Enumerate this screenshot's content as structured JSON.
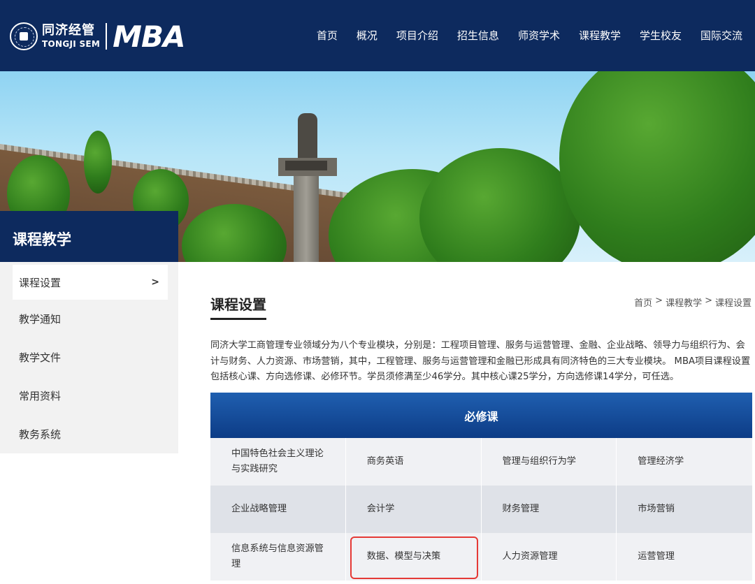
{
  "header": {
    "logo_cn": "同济经管",
    "logo_en": "TONGJI SEM",
    "logo_mba": "MBA",
    "nav": [
      "首页",
      "概况",
      "项目介绍",
      "招生信息",
      "师资学术",
      "课程教学",
      "学生校友",
      "国际交流"
    ]
  },
  "sidebar": {
    "title": "课程教学",
    "items": [
      {
        "label": "课程设置",
        "arrow": ">"
      },
      {
        "label": "教学通知"
      },
      {
        "label": "教学文件"
      },
      {
        "label": "常用资料"
      },
      {
        "label": "教务系统"
      }
    ]
  },
  "main": {
    "title": "课程设置",
    "breadcrumb": [
      "首页",
      ">",
      "课程教学",
      ">",
      "课程设置"
    ],
    "intro": "同济大学工商管理专业领域分为八个专业模块，分别是：工程项目管理、服务与运营管理、金融、企业战略、领导力与组织行为、会计与财务、人力资源、市场营销，其中，工程管理、服务与运营管理和金融已形成具有同济特色的三大专业模块。 MBA项目课程设置包括核心课、方向选修课、必修环节。学员须修满至少46学分。其中核心课25学分，方向选修课14学分，可任选。",
    "table": {
      "header": "必修课",
      "rows": [
        [
          "中国特色社会主义理论与实践研究",
          "商务英语",
          "管理与组织行为学",
          "管理经济学"
        ],
        [
          "企业战略管理",
          "会计学",
          "财务管理",
          "市场营销"
        ],
        [
          "信息系统与信息资源管理",
          "数据、模型与决策",
          "人力资源管理",
          "运营管理"
        ]
      ]
    }
  },
  "colors": {
    "navy": "#0d2a5e",
    "table_header": "#1f5fb0",
    "highlight": "#e53935"
  }
}
